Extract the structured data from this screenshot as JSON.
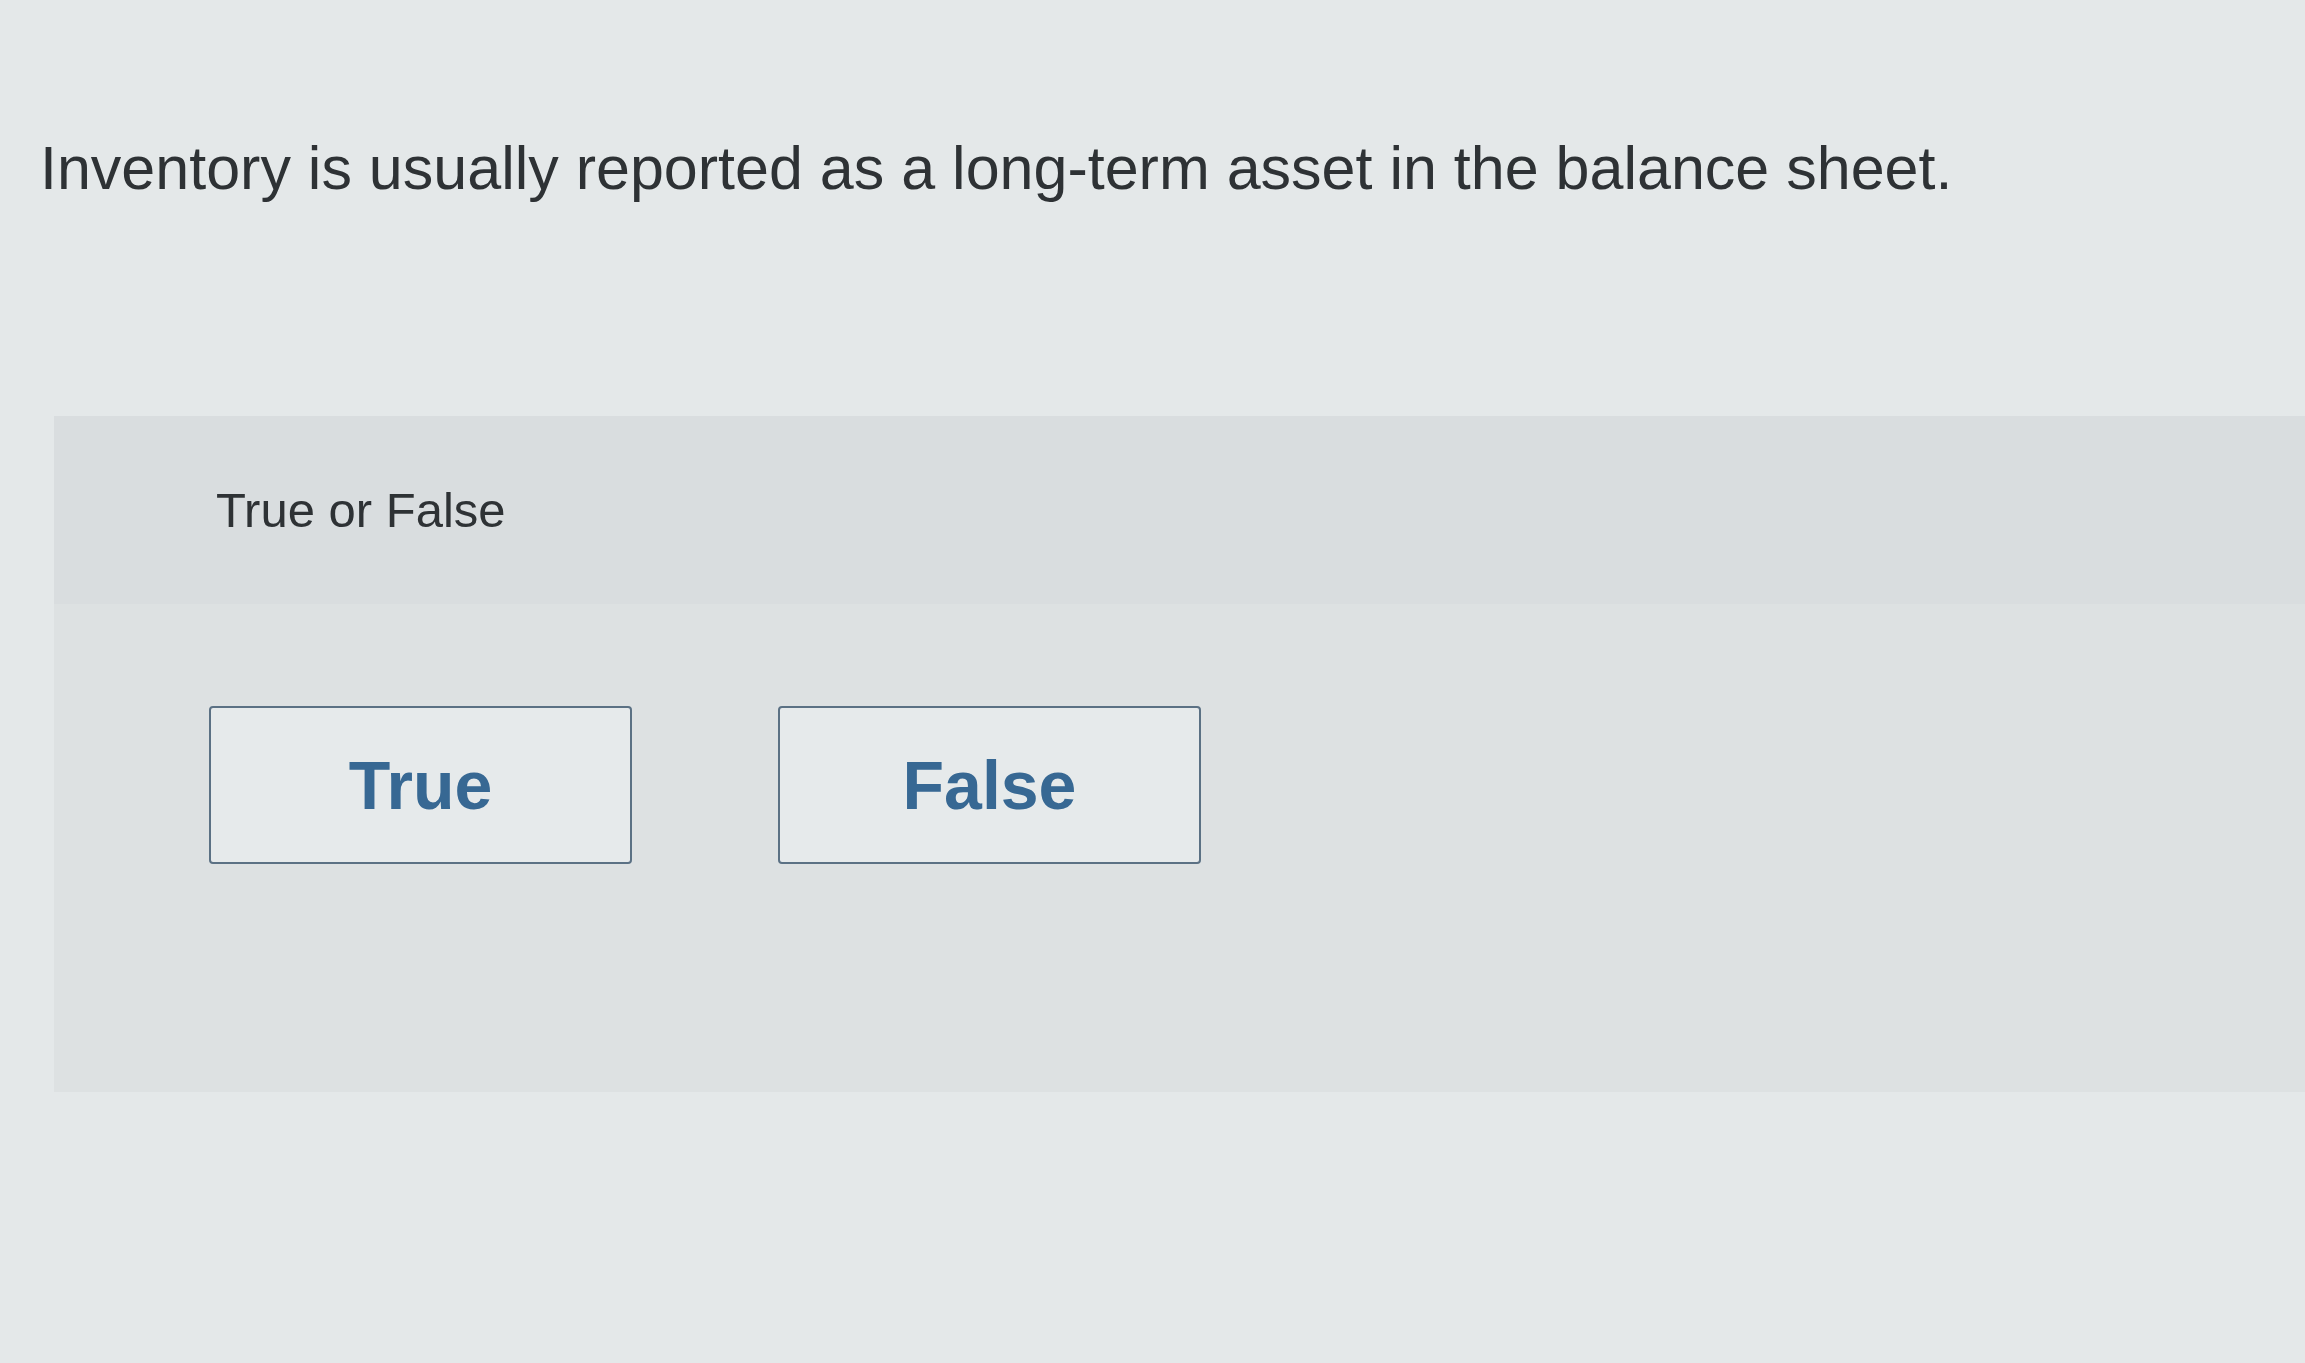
{
  "question": {
    "text": "Inventory is usually reported as a long-term asset in the balance sheet."
  },
  "answer_panel": {
    "prompt": "True or False",
    "options": [
      {
        "label": "True",
        "selected": false
      },
      {
        "label": "False",
        "selected": false
      }
    ]
  }
}
